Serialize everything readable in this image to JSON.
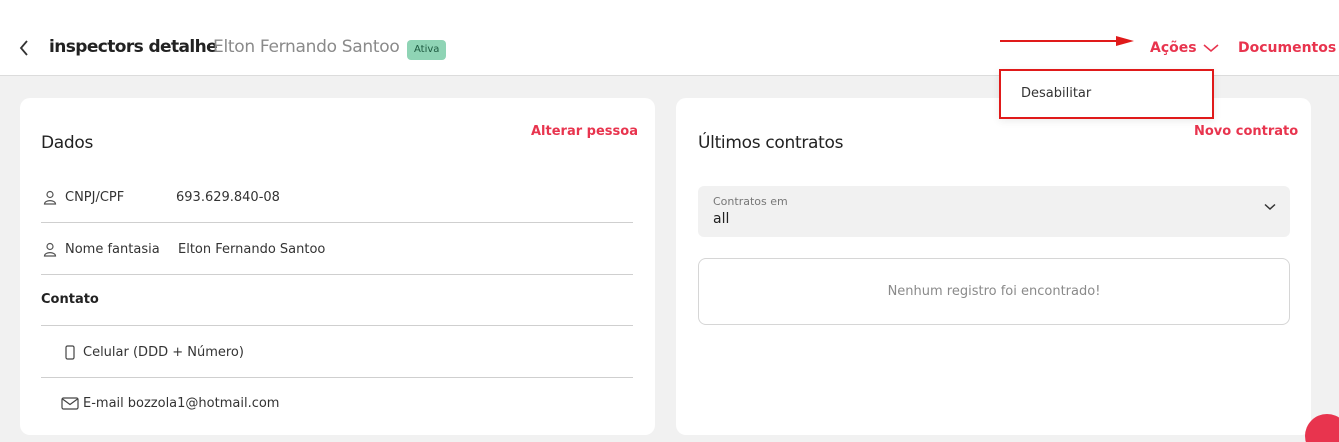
{
  "header": {
    "page_title": "inspectors detalhe",
    "person_name": "Elton Fernando Santoo",
    "status": "Ativa",
    "actions_label": "Ações",
    "documents_label": "Documentos"
  },
  "actions_menu": {
    "items": [
      "Desabilitar"
    ]
  },
  "dados": {
    "title": "Dados",
    "edit_link": "Alterar pessoa",
    "fields": [
      {
        "label": "CNPJ/CPF",
        "value": "693.629.840-08"
      },
      {
        "label": "Nome fantasia",
        "value": "Elton Fernando Santoo"
      }
    ],
    "contato_title": "Contato",
    "phone_label": "Celular (DDD + Número)",
    "email_label": "E-mail",
    "email_value": "bozzola1@hotmail.com"
  },
  "contracts": {
    "title": "Últimos contratos",
    "new_link": "Novo contrato",
    "filter_label": "Contratos em",
    "filter_value": "all",
    "empty_message": "Nenhum registro foi encontrado!"
  },
  "colors": {
    "accent": "#e8344e",
    "badge": "#8fd4b5",
    "annotation": "#e01a1a"
  }
}
